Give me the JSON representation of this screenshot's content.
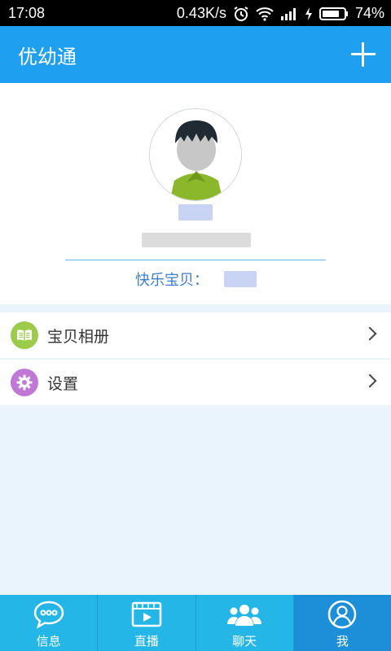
{
  "status_bar": {
    "time": "17:08",
    "speed": "0.43K/s",
    "battery": "74%"
  },
  "app_bar": {
    "title": "优幼通"
  },
  "profile": {
    "baby_label": "快乐宝贝："
  },
  "menu": [
    {
      "label": "宝贝相册",
      "icon": "album-icon",
      "color": "#9ccb4b"
    },
    {
      "label": "设置",
      "icon": "gear-icon",
      "color": "#c078d6"
    }
  ],
  "tabs": [
    {
      "label": "信息",
      "icon": "message-icon",
      "active": false
    },
    {
      "label": "直播",
      "icon": "video-icon",
      "active": false
    },
    {
      "label": "聊天",
      "icon": "people-icon",
      "active": false
    },
    {
      "label": "我",
      "icon": "person-icon",
      "active": true
    }
  ],
  "colors": {
    "primary": "#1e9ff0",
    "tab_bar": "#23b6e6",
    "tab_active": "#1d8fd8",
    "link_text": "#3a7fd0"
  }
}
